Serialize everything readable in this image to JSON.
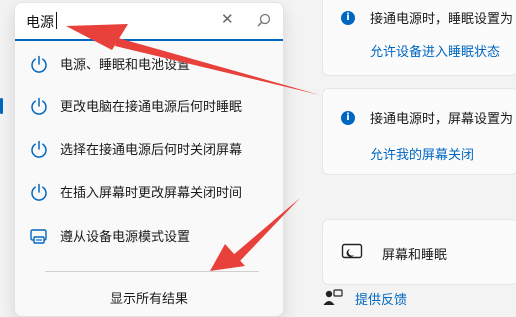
{
  "search": {
    "value": "电源"
  },
  "results": [
    {
      "label": "电源、睡眠和电池设置",
      "icon": "power-icon"
    },
    {
      "label": "更改电脑在接通电源后何时睡眠",
      "icon": "power-icon"
    },
    {
      "label": "选择在接通电源后何时关闭屏幕",
      "icon": "power-icon"
    },
    {
      "label": "在插入屏幕时更改屏幕关闭时间",
      "icon": "power-icon"
    },
    {
      "label": "遵从设备电源模式设置",
      "icon": "device-settings-icon"
    }
  ],
  "show_all": "显示所有结果",
  "right": {
    "card1": {
      "info": "接通电源时，睡眠设置为",
      "link": "允许设备进入睡眠状态"
    },
    "card2": {
      "info": "接通电源时，屏幕设置为",
      "link": "允许我的屏幕关闭"
    },
    "card3": {
      "label": "屏幕和睡眠"
    },
    "feedback": "提供反馈"
  },
  "colors": {
    "accent": "#0067c0",
    "annotation_arrow": "#e8403a"
  }
}
